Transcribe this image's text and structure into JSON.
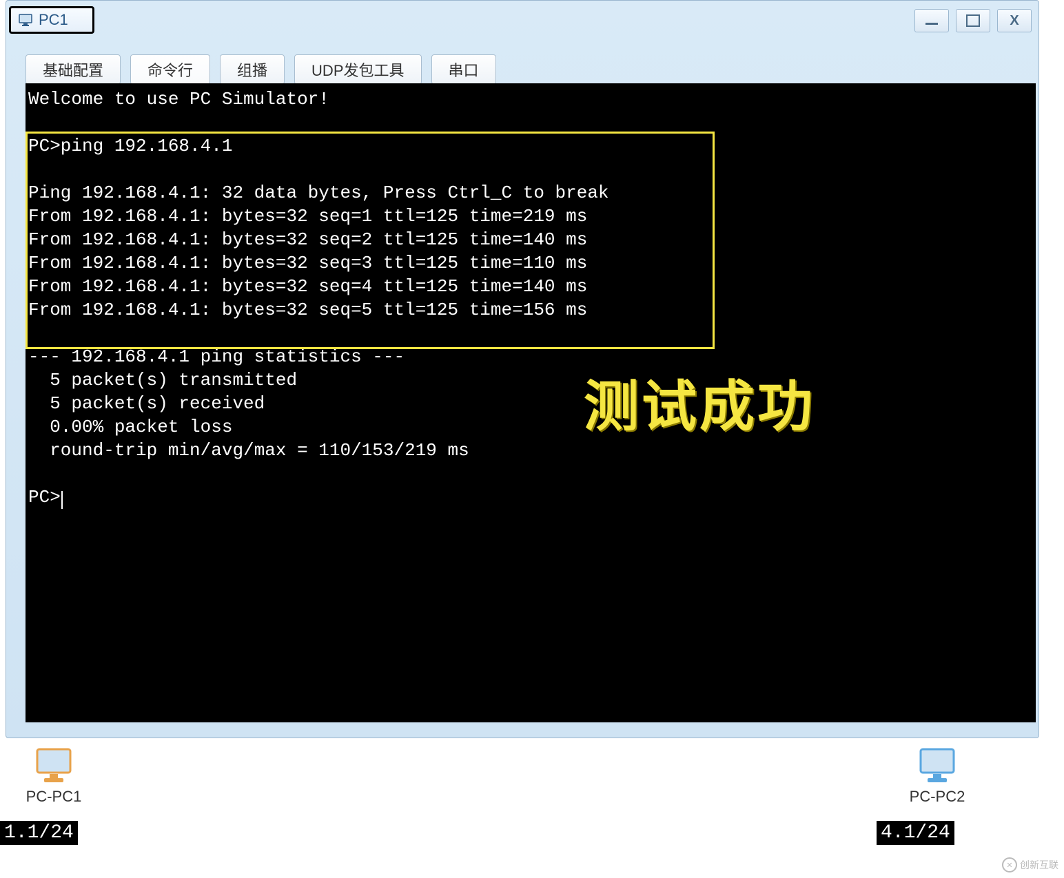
{
  "window": {
    "tab_label": "PC1",
    "controls": {
      "min": "—",
      "max": "□",
      "close": "X"
    }
  },
  "tabs": [
    {
      "label": "基础配置"
    },
    {
      "label": "命令行"
    },
    {
      "label": "组播"
    },
    {
      "label": "UDP发包工具"
    },
    {
      "label": "串口"
    }
  ],
  "terminal": {
    "welcome": "Welcome to use PC Simulator!",
    "lines": [
      "PC>ping 192.168.4.1",
      "",
      "Ping 192.168.4.1: 32 data bytes, Press Ctrl_C to break",
      "From 192.168.4.1: bytes=32 seq=1 ttl=125 time=219 ms",
      "From 192.168.4.1: bytes=32 seq=2 ttl=125 time=140 ms",
      "From 192.168.4.1: bytes=32 seq=3 ttl=125 time=110 ms",
      "From 192.168.4.1: bytes=32 seq=4 ttl=125 time=140 ms",
      "From 192.168.4.1: bytes=32 seq=5 ttl=125 time=156 ms"
    ],
    "stats": [
      "--- 192.168.4.1 ping statistics ---",
      "  5 packet(s) transmitted",
      "  5 packet(s) received",
      "  0.00% packet loss",
      "  round-trip min/avg/max = 110/153/219 ms"
    ],
    "prompt": "PC>"
  },
  "overlay": {
    "text": "测试成功"
  },
  "topology": {
    "pc1": {
      "label": "PC-PC1",
      "ip": "1.1/24",
      "color": "#e8a24a"
    },
    "pc2": {
      "label": "PC-PC2",
      "ip": "4.1/24",
      "color": "#5aa7e0"
    }
  },
  "watermark": "创新互联"
}
